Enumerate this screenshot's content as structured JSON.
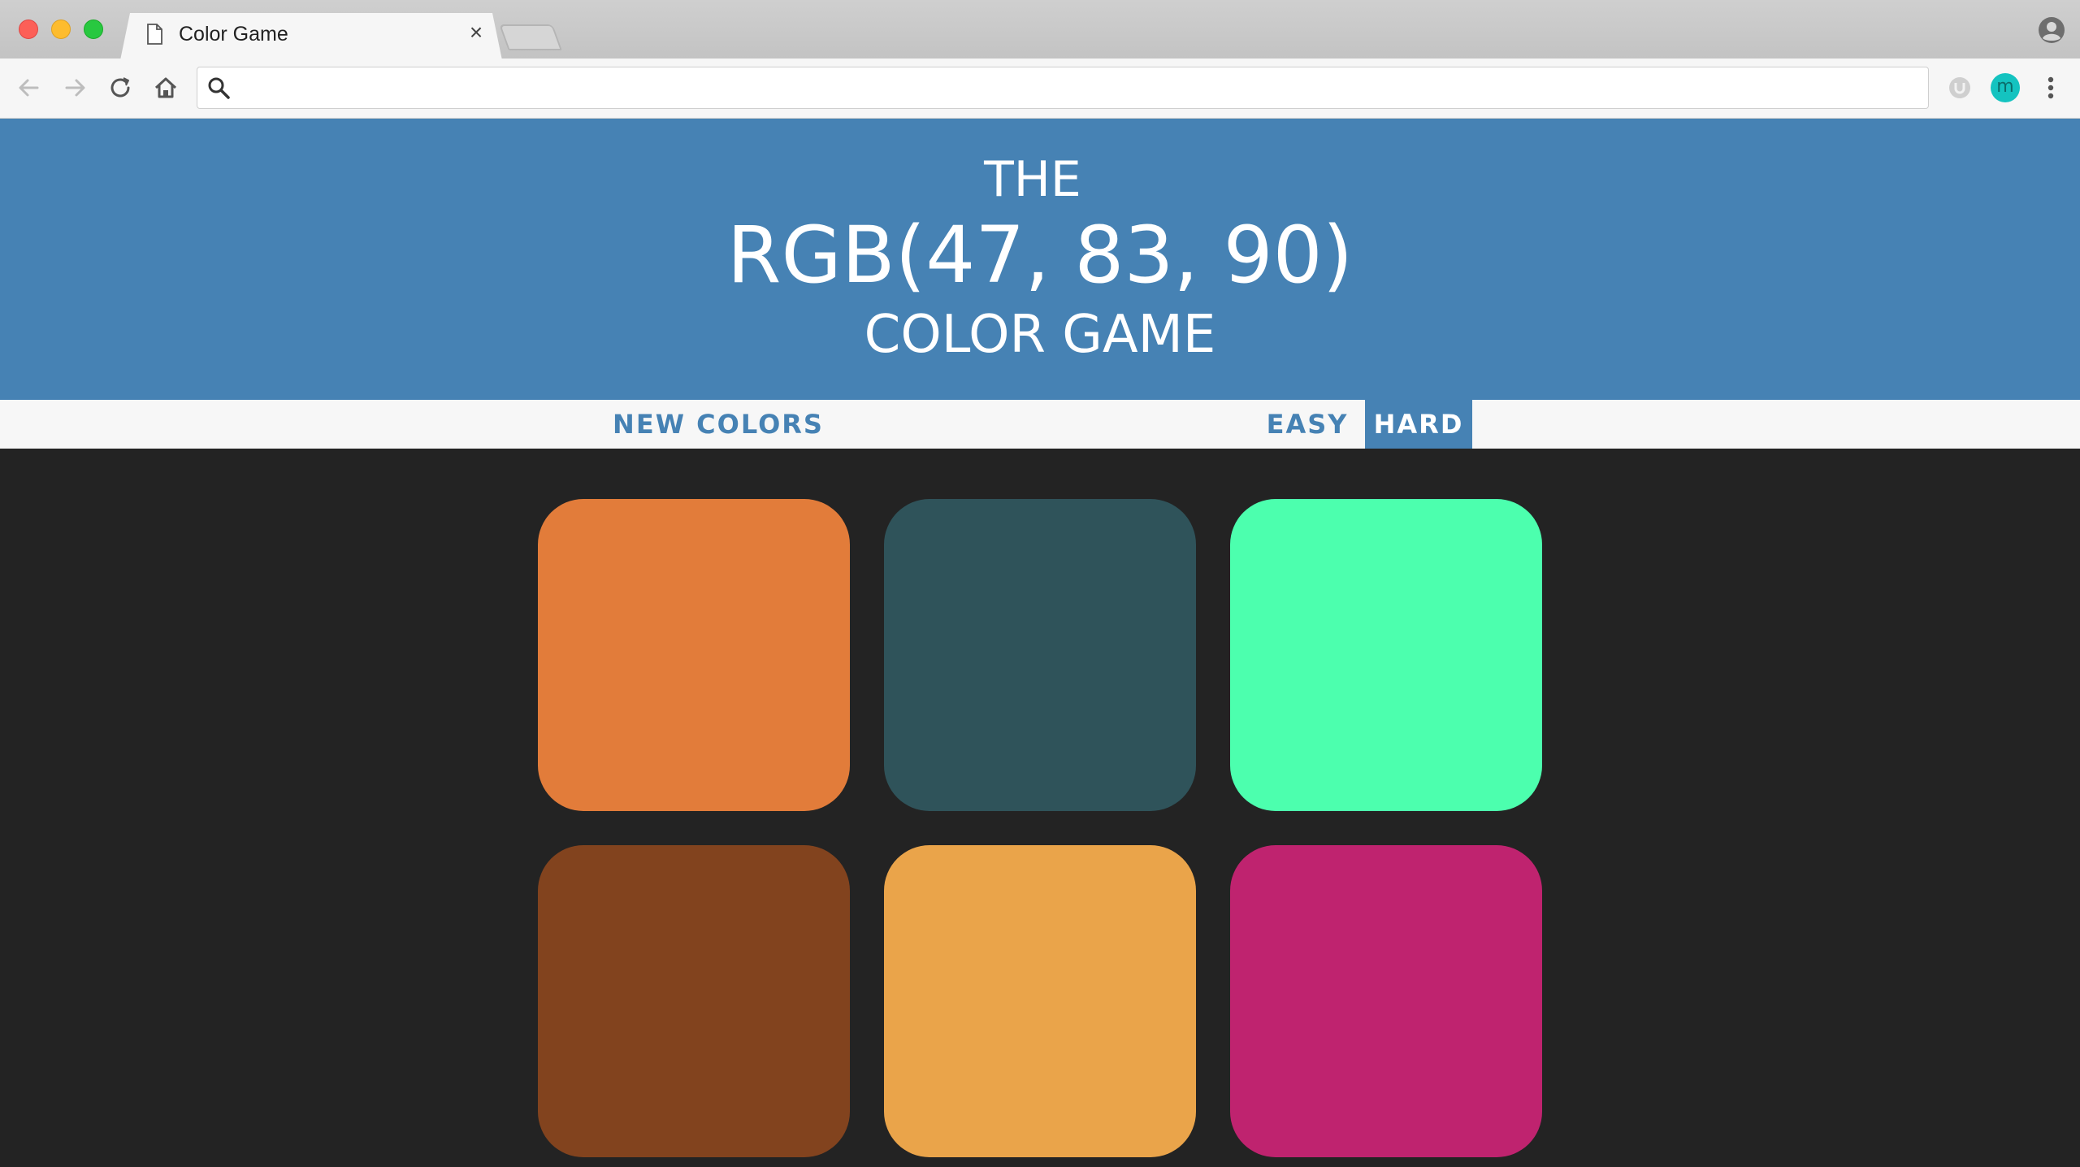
{
  "browser": {
    "tab_title": "Color Game",
    "tab_close_glyph": "×",
    "address_value": "",
    "address_placeholder": "",
    "avatar_letter": "m"
  },
  "game": {
    "header_line1": "THE",
    "rgb_display": "RGB(47, 83, 90)",
    "header_line3": "COLOR GAME",
    "new_colors_label": "NEW COLORS",
    "easy_label": "EASY",
    "hard_label": "HARD",
    "selected_mode": "HARD"
  },
  "colors": {
    "header_bg": "#4682b4",
    "stripe_bg": "#f7f7f7",
    "page_bg": "#232323",
    "squares": [
      "rgb(226, 124, 58)",
      "rgb(47, 83, 90)",
      "rgb(76, 255, 174)",
      "rgb(130, 67, 30)",
      "rgb(234, 164, 74)",
      "rgb(191, 35, 111)"
    ]
  },
  "icons": {
    "back": "back-arrow-icon",
    "forward": "forward-arrow-icon",
    "reload": "reload-icon",
    "home": "home-icon",
    "search": "search-icon",
    "extension": "extension-icon",
    "menu": "kebab-menu-icon",
    "profile": "profile-icon",
    "document": "document-icon"
  }
}
